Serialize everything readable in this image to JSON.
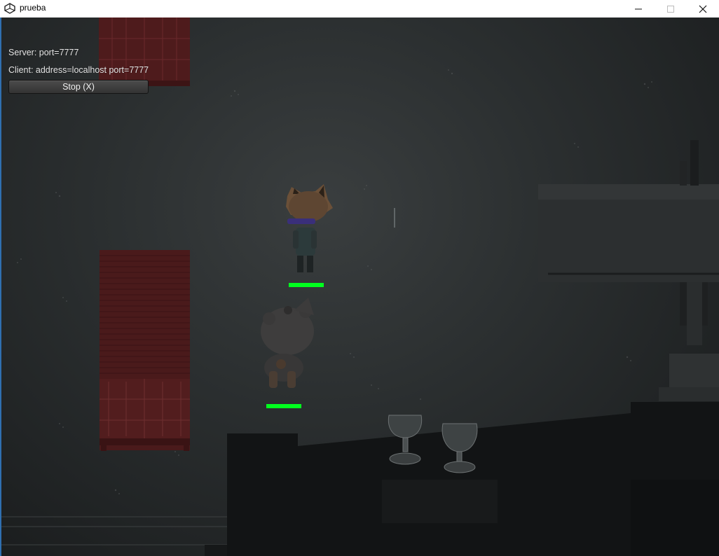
{
  "window": {
    "title": "prueba",
    "icon": "unity-icon",
    "controls": {
      "minimize": "minimize-icon",
      "maximize": "maximize-icon",
      "close": "close-icon"
    }
  },
  "network_hud": {
    "server_text": "Server: port=7777",
    "client_text": "Client: address=localhost port=7777",
    "stop_button_label": "Stop (X)"
  },
  "players": [
    {
      "name": "fox-character",
      "health_fraction": 1.0
    },
    {
      "name": "bear-character",
      "health_fraction": 1.0
    }
  ],
  "colors": {
    "health": "#00ff1e",
    "crate": "#5a1f1f",
    "floor": "#2b2f30"
  }
}
